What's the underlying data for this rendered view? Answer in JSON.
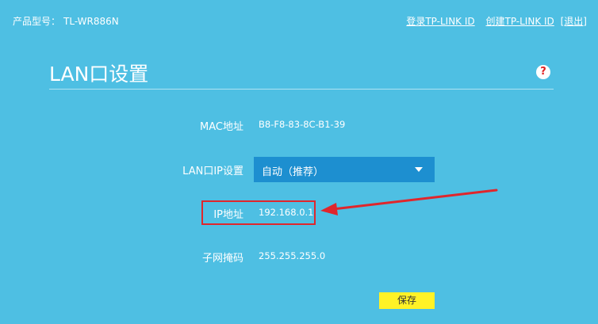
{
  "header": {
    "model_label": "产品型号：",
    "model_value": "TL-WR886N",
    "links": [
      "登录TP-LINK ID",
      "创建TP-LINK ID",
      "[退出]"
    ]
  },
  "page": {
    "title": "LAN口设置",
    "help_icon": "?"
  },
  "form": {
    "mac_label": "MAC地址",
    "mac_value": "B8-F8-83-8C-B1-39",
    "lan_ip_label": "LAN口IP设置",
    "lan_ip_selected": "自动（推荐）",
    "ip_label": "IP地址",
    "ip_value": "192.168.0.1",
    "mask_label": "子网掩码",
    "mask_value": "255.255.255.0",
    "save_label": "保存"
  },
  "colors": {
    "background": "#4ebfe3",
    "select": "#1d8fd0",
    "save_button": "#fff226",
    "annotation": "#e0262c"
  },
  "icons": [
    "question-mark-icon",
    "chevron-down-icon",
    "annotation-arrow-icon"
  ]
}
